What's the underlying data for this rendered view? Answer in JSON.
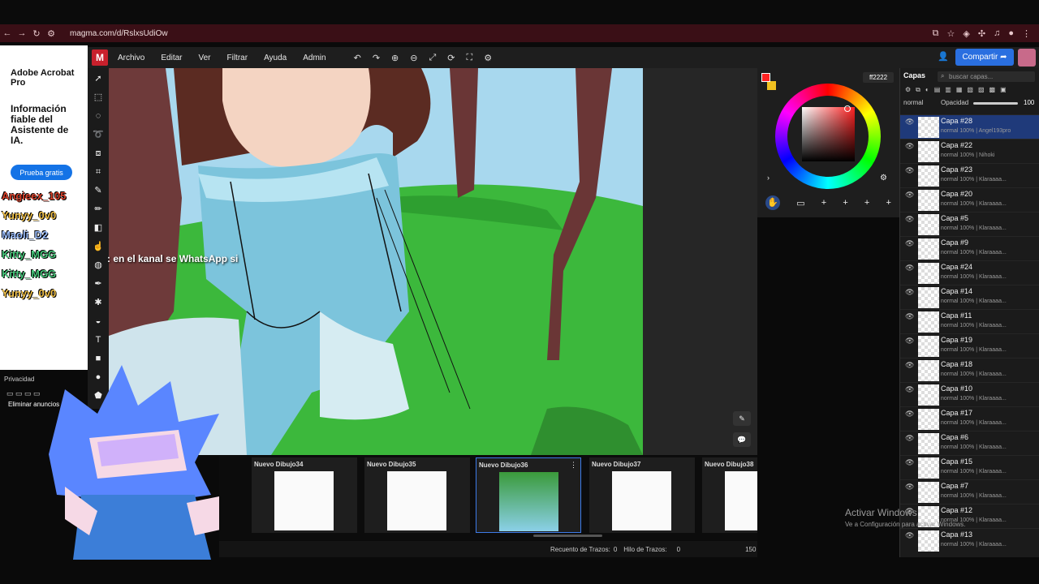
{
  "browser": {
    "url": "magma.com/d/RslxsUdiOw"
  },
  "ad": {
    "brand": "Adobe Acrobat Pro",
    "headline": "Información fiable del Asistente de IA.",
    "cta": "Prueba gratis",
    "privacy": "Privacidad",
    "remove_ads": "Eliminar anuncios"
  },
  "menu": {
    "logo": "M",
    "items": [
      "Archivo",
      "Editar",
      "Ver",
      "Filtrar",
      "Ayuda",
      "Admin"
    ]
  },
  "share_label": "Compartir",
  "chat": {
    "names": [
      "Angieex_105",
      "Yunyy_0v0",
      "Maoli_D2",
      "Kitty_MGG",
      "Kitty_MGG",
      "Yunyy_0v0"
    ],
    "message": ": en el kanal se WhatsApp si"
  },
  "gallery": {
    "items": [
      {
        "title": "Nuevo Dibujo34",
        "selected": false
      },
      {
        "title": "Nuevo Dibujo35",
        "selected": false
      },
      {
        "title": "Nuevo Dibujo36",
        "selected": true
      },
      {
        "title": "Nuevo Dibujo37",
        "selected": false
      },
      {
        "title": "Nuevo Dibujo38",
        "selected": false
      }
    ]
  },
  "status": {
    "stroke_count_label": "Recuento de Trazos:",
    "stroke_count": "0",
    "thread_label": "Hilo de Trazos:",
    "thread_value": "0",
    "zoom": "150"
  },
  "color": {
    "hex": "ff2222",
    "primary": "#ff2222",
    "secondary": "#f0c020"
  },
  "layers": {
    "title": "Capas",
    "search_placeholder": "buscar capas...",
    "blend": "normal",
    "opacity_label": "Opacidad",
    "opacity": "100",
    "opacity_fraction": 1.0,
    "items": [
      {
        "name": "Capa #28",
        "meta": "normal 100% | Angel193pro",
        "selected": true
      },
      {
        "name": "Capa #22",
        "meta": "normal 100% | Nihoki",
        "selected": false
      },
      {
        "name": "Capa #23",
        "meta": "normal 100% | Klaraaaa...",
        "selected": false
      },
      {
        "name": "Capa #20",
        "meta": "normal 100% | Klaraaaa...",
        "selected": false
      },
      {
        "name": "Capa #5",
        "meta": "normal 100% | Klaraaaa...",
        "selected": false
      },
      {
        "name": "Capa #9",
        "meta": "normal 100% | Klaraaaa...",
        "selected": false
      },
      {
        "name": "Capa #24",
        "meta": "normal 100% | Klaraaaa...",
        "selected": false
      },
      {
        "name": "Capa #14",
        "meta": "normal 100% | Klaraaaa...",
        "selected": false
      },
      {
        "name": "Capa #11",
        "meta": "normal 100% | Klaraaaa...",
        "selected": false
      },
      {
        "name": "Capa #19",
        "meta": "normal 100% | Klaraaaa...",
        "selected": false
      },
      {
        "name": "Capa #18",
        "meta": "normal 100% | Klaraaaa...",
        "selected": false
      },
      {
        "name": "Capa #10",
        "meta": "normal 100% | Klaraaaa...",
        "selected": false
      },
      {
        "name": "Capa #17",
        "meta": "normal 100% | Klaraaaa...",
        "selected": false
      },
      {
        "name": "Capa #6",
        "meta": "normal 100% | Klaraaaa...",
        "selected": false
      },
      {
        "name": "Capa #15",
        "meta": "normal 100% | Klaraaaa...",
        "selected": false
      },
      {
        "name": "Capa #7",
        "meta": "normal 100% | Klaraaaa...",
        "selected": false
      },
      {
        "name": "Capa #12",
        "meta": "normal 100% | Klaraaaa...",
        "selected": false
      },
      {
        "name": "Capa #13",
        "meta": "normal 100% | Klaraaaa...",
        "selected": false
      }
    ]
  },
  "watermark": {
    "title": "Activar Windows",
    "subtitle": "Ve a Configuración para activar Windows."
  }
}
